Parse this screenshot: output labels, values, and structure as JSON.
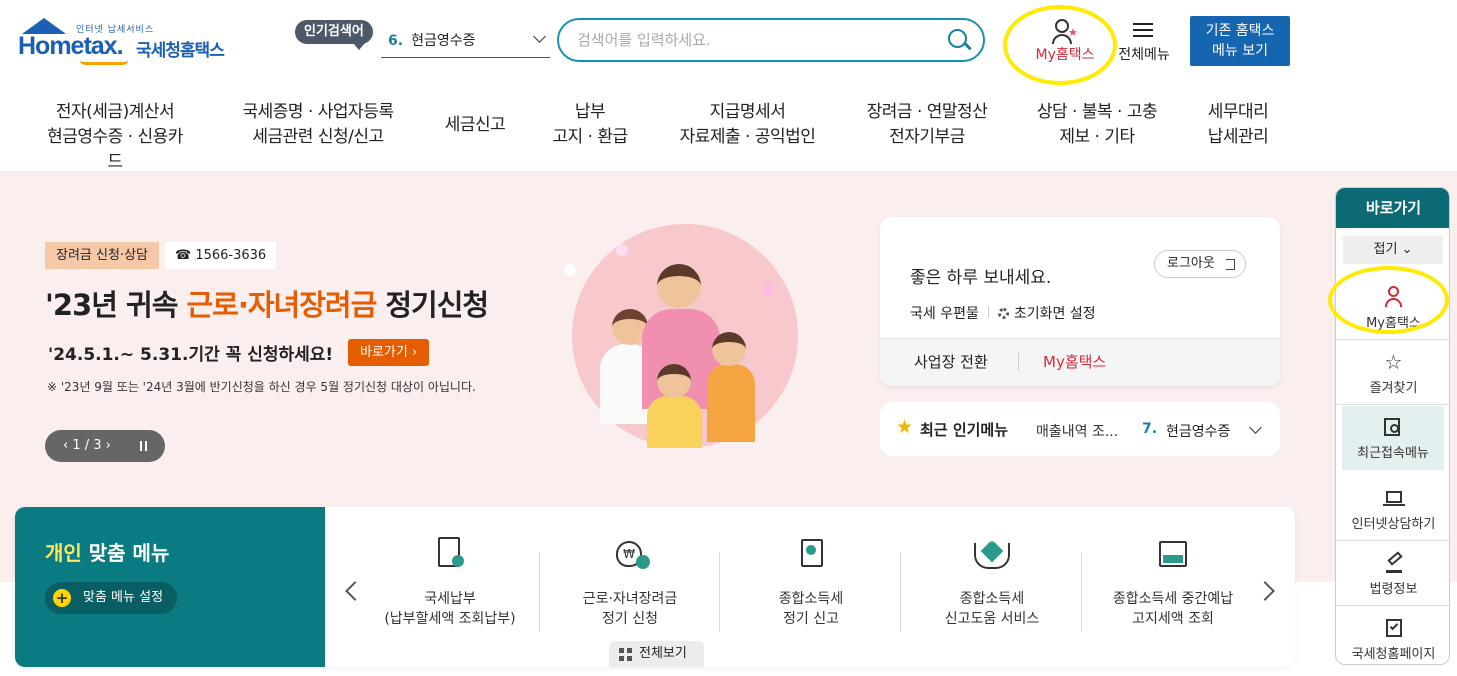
{
  "header": {
    "logo_tagline": "인터넷 납세서비스",
    "logo_text": "Hometax.",
    "logo_name": "국세청홈택스",
    "popular_label": "인기검색어",
    "popular_rank": "6.",
    "popular_term": "현금영수증",
    "search_placeholder": "검색어를 입력하세요.",
    "my_hometax": "My홈택스",
    "all_menu": "전체메뉴",
    "old_btn_line1": "기존 홈택스",
    "old_btn_line2": "메뉴 보기"
  },
  "gnb": [
    {
      "l1": "전자(세금)계산서",
      "l2": "현금영수증 · 신용카드"
    },
    {
      "l1": "국세증명 · 사업자등록",
      "l2": "세금관련 신청/신고"
    },
    {
      "l1": "세금신고",
      "l2": ""
    },
    {
      "l1": "납부",
      "l2": "고지 · 환급"
    },
    {
      "l1": "지급명세서",
      "l2": "자료제출 · 공익법인"
    },
    {
      "l1": "장려금 · 연말정산",
      "l2": "전자기부금"
    },
    {
      "l1": "상담 · 불복 · 고충",
      "l2": "제보 · 기타"
    },
    {
      "l1": "세무대리",
      "l2": "납세관리"
    }
  ],
  "banner": {
    "tag": "장려금 신청·상담",
    "tel": "☎ 1566-3636",
    "title_pre": "'23년 귀속 ",
    "title_hi": "근로·자녀장려금",
    "title_post": " 정기신청",
    "sub": "'24.5.1.~ 5.31.기간 꼭 신청하세요!",
    "go_btn": "바로가기 ›",
    "note": "※ '23년 9월 또는 '24년 3월에 반기신청을 하신 경우 5월 정기신청 대상이 아닙니다.",
    "pager": "‹  1 / 3  ›"
  },
  "login": {
    "greeting": "좋은 하루 보내세요.",
    "logout": "로그아웃",
    "mail": "국세 우편물",
    "init": "초기화면 설정",
    "switch": "사업장 전환",
    "my": "My홈택스"
  },
  "recent": {
    "title": "최근 인기메뉴",
    "menu": "매출내역 조...",
    "rank": "7.",
    "term": "현금영수증"
  },
  "personal": {
    "title_hi": "개인",
    "title_rest": " 맞춤 메뉴",
    "setting": "맞춤 메뉴 설정",
    "items": [
      {
        "l1": "국세납부",
        "l2": "(납부할세액 조회납부)"
      },
      {
        "l1": "근로·자녀장려금",
        "l2": "정기 신청"
      },
      {
        "l1": "종합소득세",
        "l2": "정기 신고"
      },
      {
        "l1": "종합소득세",
        "l2": "신고도움 서비스"
      },
      {
        "l1": "종합소득세 중간예납",
        "l2": "고지세액 조회"
      }
    ],
    "view_all": "전체보기"
  },
  "quick": {
    "title": "바로가기",
    "fold": "접기 ⌄",
    "items": [
      "My홈택스",
      "즐겨찾기",
      "최근접속메뉴",
      "인터넷상담하기",
      "법령정보",
      "국세청홈페이지"
    ]
  },
  "colors": {
    "primary": "#1a5fb4",
    "teal": "#0b7b82",
    "accent": "#e65c00",
    "highlight": "#ffea00",
    "my_red": "#d7283a"
  }
}
